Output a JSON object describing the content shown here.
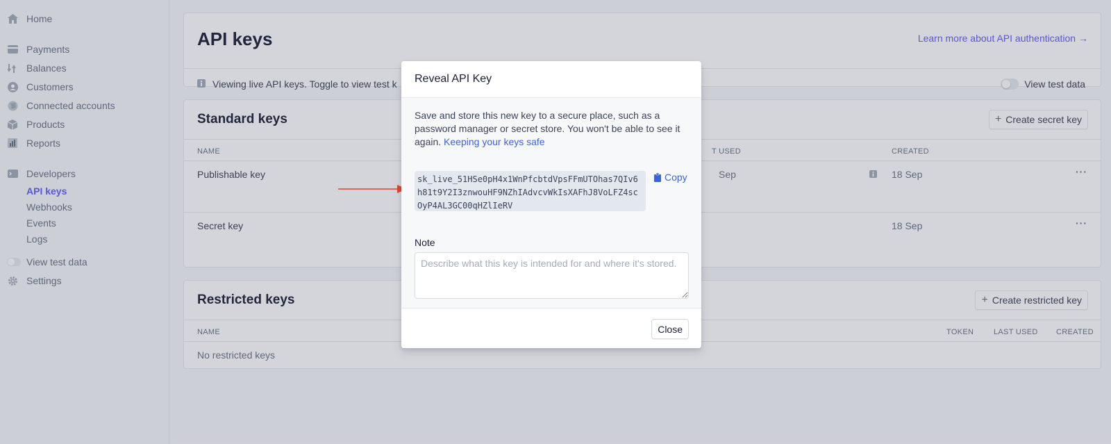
{
  "sidebar": {
    "home": "Home",
    "payments": "Payments",
    "balances": "Balances",
    "customers": "Customers",
    "connected_accounts": "Connected accounts",
    "products": "Products",
    "reports": "Reports",
    "developers": "Developers",
    "sub_items": [
      "API keys",
      "Webhooks",
      "Events",
      "Logs"
    ],
    "view_test_data": "View test data",
    "settings": "Settings"
  },
  "header": {
    "title": "API keys",
    "learn_more": "Learn more about API authentication →"
  },
  "banner": {
    "text": "Viewing live API keys. Toggle to view test k",
    "toggle_label": "View test data"
  },
  "standard_keys": {
    "title": "Standard keys",
    "create_button": "Create secret key",
    "columns": {
      "name": "NAME",
      "last_used": "T USED",
      "created": "CREATED"
    },
    "rows": [
      {
        "name": "Publishable key",
        "last_used": "Sep",
        "created": "18 Sep"
      },
      {
        "name": "Secret key",
        "created": "18 Sep"
      }
    ]
  },
  "restricted_keys": {
    "title": "Restricted keys",
    "create_button": "Create restricted key",
    "columns": {
      "name": "NAME",
      "token": "TOKEN",
      "last_used": "LAST USED",
      "created": "CREATED"
    },
    "empty_text": "No restricted keys"
  },
  "modal": {
    "title": "Reveal API Key",
    "description": "Save and store this new key to a secure place, such as a password manager or secret store. You won't be able to see it again.",
    "description_link": "Keeping your keys safe",
    "secret_key": "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",
    "copy_label": "Copy",
    "note_label": "Note",
    "note_placeholder": "Describe what this key is intended for and where it's stored.",
    "close_label": "Close"
  },
  "colors": {
    "accent": "#635bff",
    "link": "#3f63d6",
    "arrow": "#e5432b"
  }
}
